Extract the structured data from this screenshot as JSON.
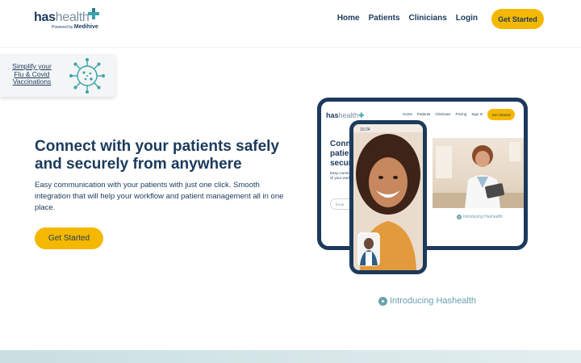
{
  "header": {
    "logo": {
      "has": "has",
      "health": "health",
      "powered_prefix": "Powered by",
      "powered_brand": "Medihive"
    },
    "nav": [
      {
        "label": "Home"
      },
      {
        "label": "Patients"
      },
      {
        "label": "Clinicians"
      },
      {
        "label": "Login"
      }
    ],
    "cta_label": "Get Started"
  },
  "vaccination_card": {
    "line1": "Simplify your",
    "line2": "Flu & Covid",
    "line3": "Vaccinations",
    "icon": "virus-icon"
  },
  "hero": {
    "title_line1": "Connect with your patients safely",
    "title_line2": "and securely from anywhere",
    "description": "Easy communication with your patients with just one click. Smooth integration that will help your workflow and patient management all in one place.",
    "cta_label": "Get Started"
  },
  "mockup": {
    "logo_has": "has",
    "logo_health": "health",
    "nav": [
      "Home",
      "Patients",
      "Clinicians",
      "Pricing",
      "Sign In"
    ],
    "cta_label": "Get Started",
    "title_line1": "Conn",
    "title_line2": "patie",
    "title_line3": "secur",
    "small_text": "Easy commun just one cli your workflo place.",
    "input_placeholder": "Emai",
    "intro_label": "Introducing Hashealth",
    "phone_status": "10:24"
  },
  "intro_link": {
    "label": "Introducing Hashealth",
    "icon": "play-circle-icon"
  },
  "colors": {
    "navy": "#1b3a5c",
    "accent_yellow": "#f5b800",
    "teal": "#6aa0ae",
    "brand_cross_teal": "#3aa3a8"
  }
}
